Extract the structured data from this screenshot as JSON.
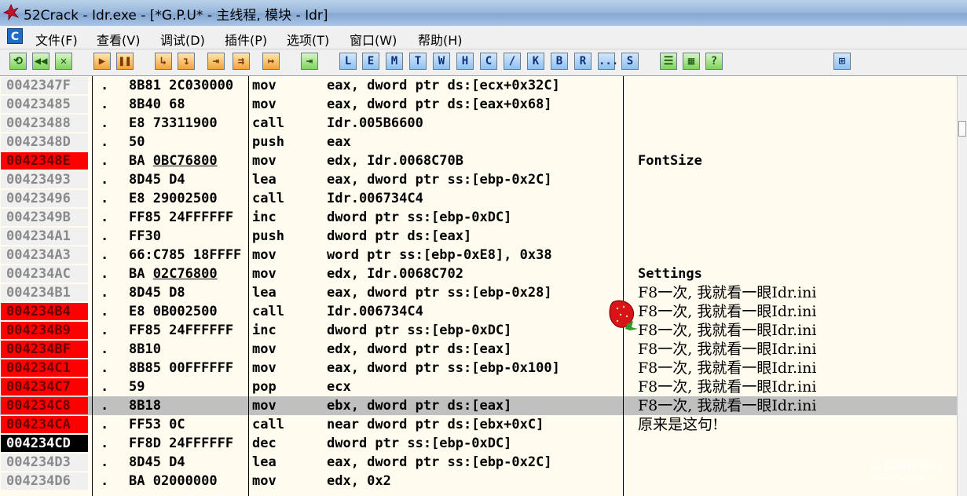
{
  "window": {
    "title": "52Crack - Idr.exe - [*G.P.U* -  主线程, 模块 - Idr]"
  },
  "menu": {
    "app_icon": "C",
    "items": [
      "文件(F)",
      "查看(V)",
      "调试(D)",
      "插件(P)",
      "选项(T)",
      "窗口(W)",
      "帮助(H)"
    ]
  },
  "toolbar": {
    "buttons": [
      {
        "icon": "open-icon",
        "glyph": "⟲",
        "style": "green"
      },
      {
        "icon": "restart-icon",
        "glyph": "◀◀",
        "style": "green"
      },
      {
        "icon": "close-icon",
        "glyph": "✕",
        "style": "green"
      },
      {
        "icon": "run-icon",
        "glyph": "▶",
        "style": "orange"
      },
      {
        "icon": "pause-icon",
        "glyph": "❚❚",
        "style": "orange"
      },
      {
        "icon": "step-into-icon",
        "glyph": "↳",
        "style": "orange"
      },
      {
        "icon": "step-over-icon",
        "glyph": "↴",
        "style": "orange"
      },
      {
        "icon": "trace-into-icon",
        "glyph": "⇥",
        "style": "orange"
      },
      {
        "icon": "trace-over-icon",
        "glyph": "⇉",
        "style": "orange"
      },
      {
        "icon": "execute-till-return-icon",
        "glyph": "↦",
        "style": "orange"
      },
      {
        "icon": "go-to-address-icon",
        "glyph": "⇥",
        "style": "green"
      }
    ],
    "letters": [
      "L",
      "E",
      "M",
      "T",
      "W",
      "H",
      "C",
      "/",
      "K",
      "B",
      "R",
      "...",
      "S"
    ],
    "extra_buttons": [
      {
        "icon": "list-icon",
        "glyph": "☰",
        "style": "green"
      },
      {
        "icon": "grid-icon",
        "glyph": "▦",
        "style": "green"
      },
      {
        "icon": "help-icon",
        "glyph": "?",
        "style": "green"
      },
      {
        "icon": "network-icon",
        "glyph": "⊞",
        "style": "blue"
      }
    ]
  },
  "disasm": {
    "rows": [
      {
        "addr": "0042347F",
        "state": "normal",
        "dot": ".",
        "hex": "8B81 2C030000",
        "hex_u": "",
        "mnem": "mov",
        "ops": "eax, dword ptr ds:[ecx+0x32C]",
        "cmt": ""
      },
      {
        "addr": "00423485",
        "state": "normal",
        "dot": ".",
        "hex": "8B40 68",
        "hex_u": "",
        "mnem": "mov",
        "ops": "eax, dword ptr ds:[eax+0x68]",
        "cmt": ""
      },
      {
        "addr": "00423488",
        "state": "normal",
        "dot": ".",
        "hex": "E8 73311900",
        "hex_u": "",
        "mnem": "call",
        "ops": "Idr.005B6600",
        "cmt": ""
      },
      {
        "addr": "0042348D",
        "state": "normal",
        "dot": ".",
        "hex": "50",
        "hex_u": "",
        "mnem": "push",
        "ops": "eax",
        "cmt": ""
      },
      {
        "addr": "0042348E",
        "state": "bp",
        "dot": ".",
        "hex": "BA ",
        "hex_u": "0BC76800",
        "mnem": "mov",
        "ops": "edx, Idr.0068C70B",
        "cmt": "FontSize"
      },
      {
        "addr": "00423493",
        "state": "normal",
        "dot": ".",
        "hex": "8D45 D4",
        "hex_u": "",
        "mnem": "lea",
        "ops": "eax, dword ptr ss:[ebp-0x2C]",
        "cmt": ""
      },
      {
        "addr": "00423496",
        "state": "normal",
        "dot": ".",
        "hex": "E8 29002500",
        "hex_u": "",
        "mnem": "call",
        "ops": "Idr.006734C4",
        "cmt": ""
      },
      {
        "addr": "0042349B",
        "state": "normal",
        "dot": ".",
        "hex": "FF85 24FFFFFF",
        "hex_u": "",
        "mnem": "inc",
        "ops": "dword ptr ss:[ebp-0xDC]",
        "cmt": ""
      },
      {
        "addr": "004234A1",
        "state": "normal",
        "dot": ".",
        "hex": "FF30",
        "hex_u": "",
        "mnem": "push",
        "ops": "dword ptr ds:[eax]",
        "cmt": ""
      },
      {
        "addr": "004234A3",
        "state": "normal",
        "dot": ".",
        "hex": "66:C785 18FFFF",
        "hex_u": "",
        "mnem": "mov",
        "ops": "word ptr ss:[ebp-0xE8], 0x38",
        "cmt": ""
      },
      {
        "addr": "004234AC",
        "state": "normal",
        "dot": ".",
        "hex": "BA ",
        "hex_u": "02C76800",
        "mnem": "mov",
        "ops": "edx, Idr.0068C702",
        "cmt": "Settings"
      },
      {
        "addr": "004234B1",
        "state": "normal",
        "dot": ".",
        "hex": "8D45 D8",
        "hex_u": "",
        "mnem": "lea",
        "ops": "eax, dword ptr ss:[ebp-0x28]",
        "cmt": "F8一次, 我就看一眼Idr.ini"
      },
      {
        "addr": "004234B4",
        "state": "bp",
        "dot": ".",
        "hex": "E8 0B002500",
        "hex_u": "",
        "mnem": "call",
        "ops": "Idr.006734C4",
        "cmt": "F8一次, 我就看一眼Idr.ini"
      },
      {
        "addr": "004234B9",
        "state": "bp",
        "dot": ".",
        "hex": "FF85 24FFFFFF",
        "hex_u": "",
        "mnem": "inc",
        "ops": "dword ptr ss:[ebp-0xDC]",
        "cmt": "F8一次, 我就看一眼Idr.ini"
      },
      {
        "addr": "004234BF",
        "state": "bp",
        "dot": ".",
        "hex": "8B10",
        "hex_u": "",
        "mnem": "mov",
        "ops": "edx, dword ptr ds:[eax]",
        "cmt": "F8一次, 我就看一眼Idr.ini"
      },
      {
        "addr": "004234C1",
        "state": "bp",
        "dot": ".",
        "hex": "8B85 00FFFFFF",
        "hex_u": "",
        "mnem": "mov",
        "ops": "eax, dword ptr ss:[ebp-0x100]",
        "cmt": "F8一次, 我就看一眼Idr.ini"
      },
      {
        "addr": "004234C7",
        "state": "bp",
        "dot": ".",
        "hex": "59",
        "hex_u": "",
        "mnem": "pop",
        "ops": "ecx",
        "cmt": "F8一次, 我就看一眼Idr.ini"
      },
      {
        "addr": "004234C8",
        "state": "bp",
        "dot": ".",
        "hex": "8B18",
        "hex_u": "",
        "mnem": "mov",
        "ops": "ebx, dword ptr ds:[eax]",
        "cmt": "F8一次, 我就看一眼Idr.ini",
        "selected": true
      },
      {
        "addr": "004234CA",
        "state": "bp",
        "dot": ".",
        "hex": "FF53 0C",
        "hex_u": "",
        "mnem": "call",
        "ops": "near dword ptr ds:[ebx+0xC]",
        "cmt": "原来是这句!"
      },
      {
        "addr": "004234CD",
        "state": "eip",
        "dot": ".",
        "hex": "FF8D 24FFFFFF",
        "hex_u": "",
        "mnem": "dec",
        "ops": "dword ptr ss:[ebp-0xDC]",
        "cmt": ""
      },
      {
        "addr": "004234D3",
        "state": "normal",
        "dot": ".",
        "hex": "8D45 D4",
        "hex_u": "",
        "mnem": "lea",
        "ops": "eax, dword ptr ss:[ebp-0x2C]",
        "cmt": ""
      },
      {
        "addr": "004234D6",
        "state": "normal",
        "dot": ".",
        "hex": "BA 02000000",
        "hex_u": "",
        "mnem": "mov",
        "ops": "edx, 0x2",
        "cmt": ""
      }
    ]
  },
  "watermark": {
    "line1": "吾爱破解论坛",
    "line2": "www.52pojie.cn"
  }
}
